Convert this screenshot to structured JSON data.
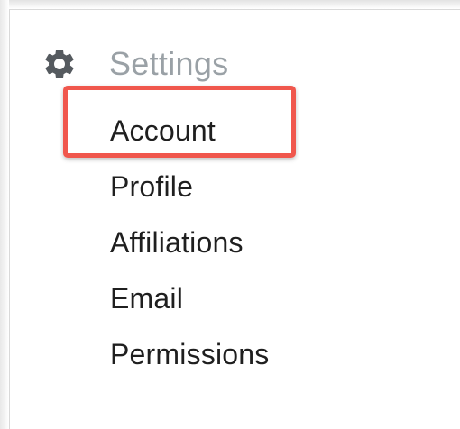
{
  "settings_menu": {
    "title": "Settings",
    "icon": "gear-icon",
    "items": [
      {
        "label": "Account",
        "highlighted": true
      },
      {
        "label": "Profile"
      },
      {
        "label": "Affiliations"
      },
      {
        "label": "Email"
      },
      {
        "label": "Permissions"
      }
    ]
  },
  "colors": {
    "highlight_border": "#f0574d",
    "title_text": "#9aa1a6",
    "item_text": "#1f1f1f",
    "icon": "#555a5f"
  }
}
